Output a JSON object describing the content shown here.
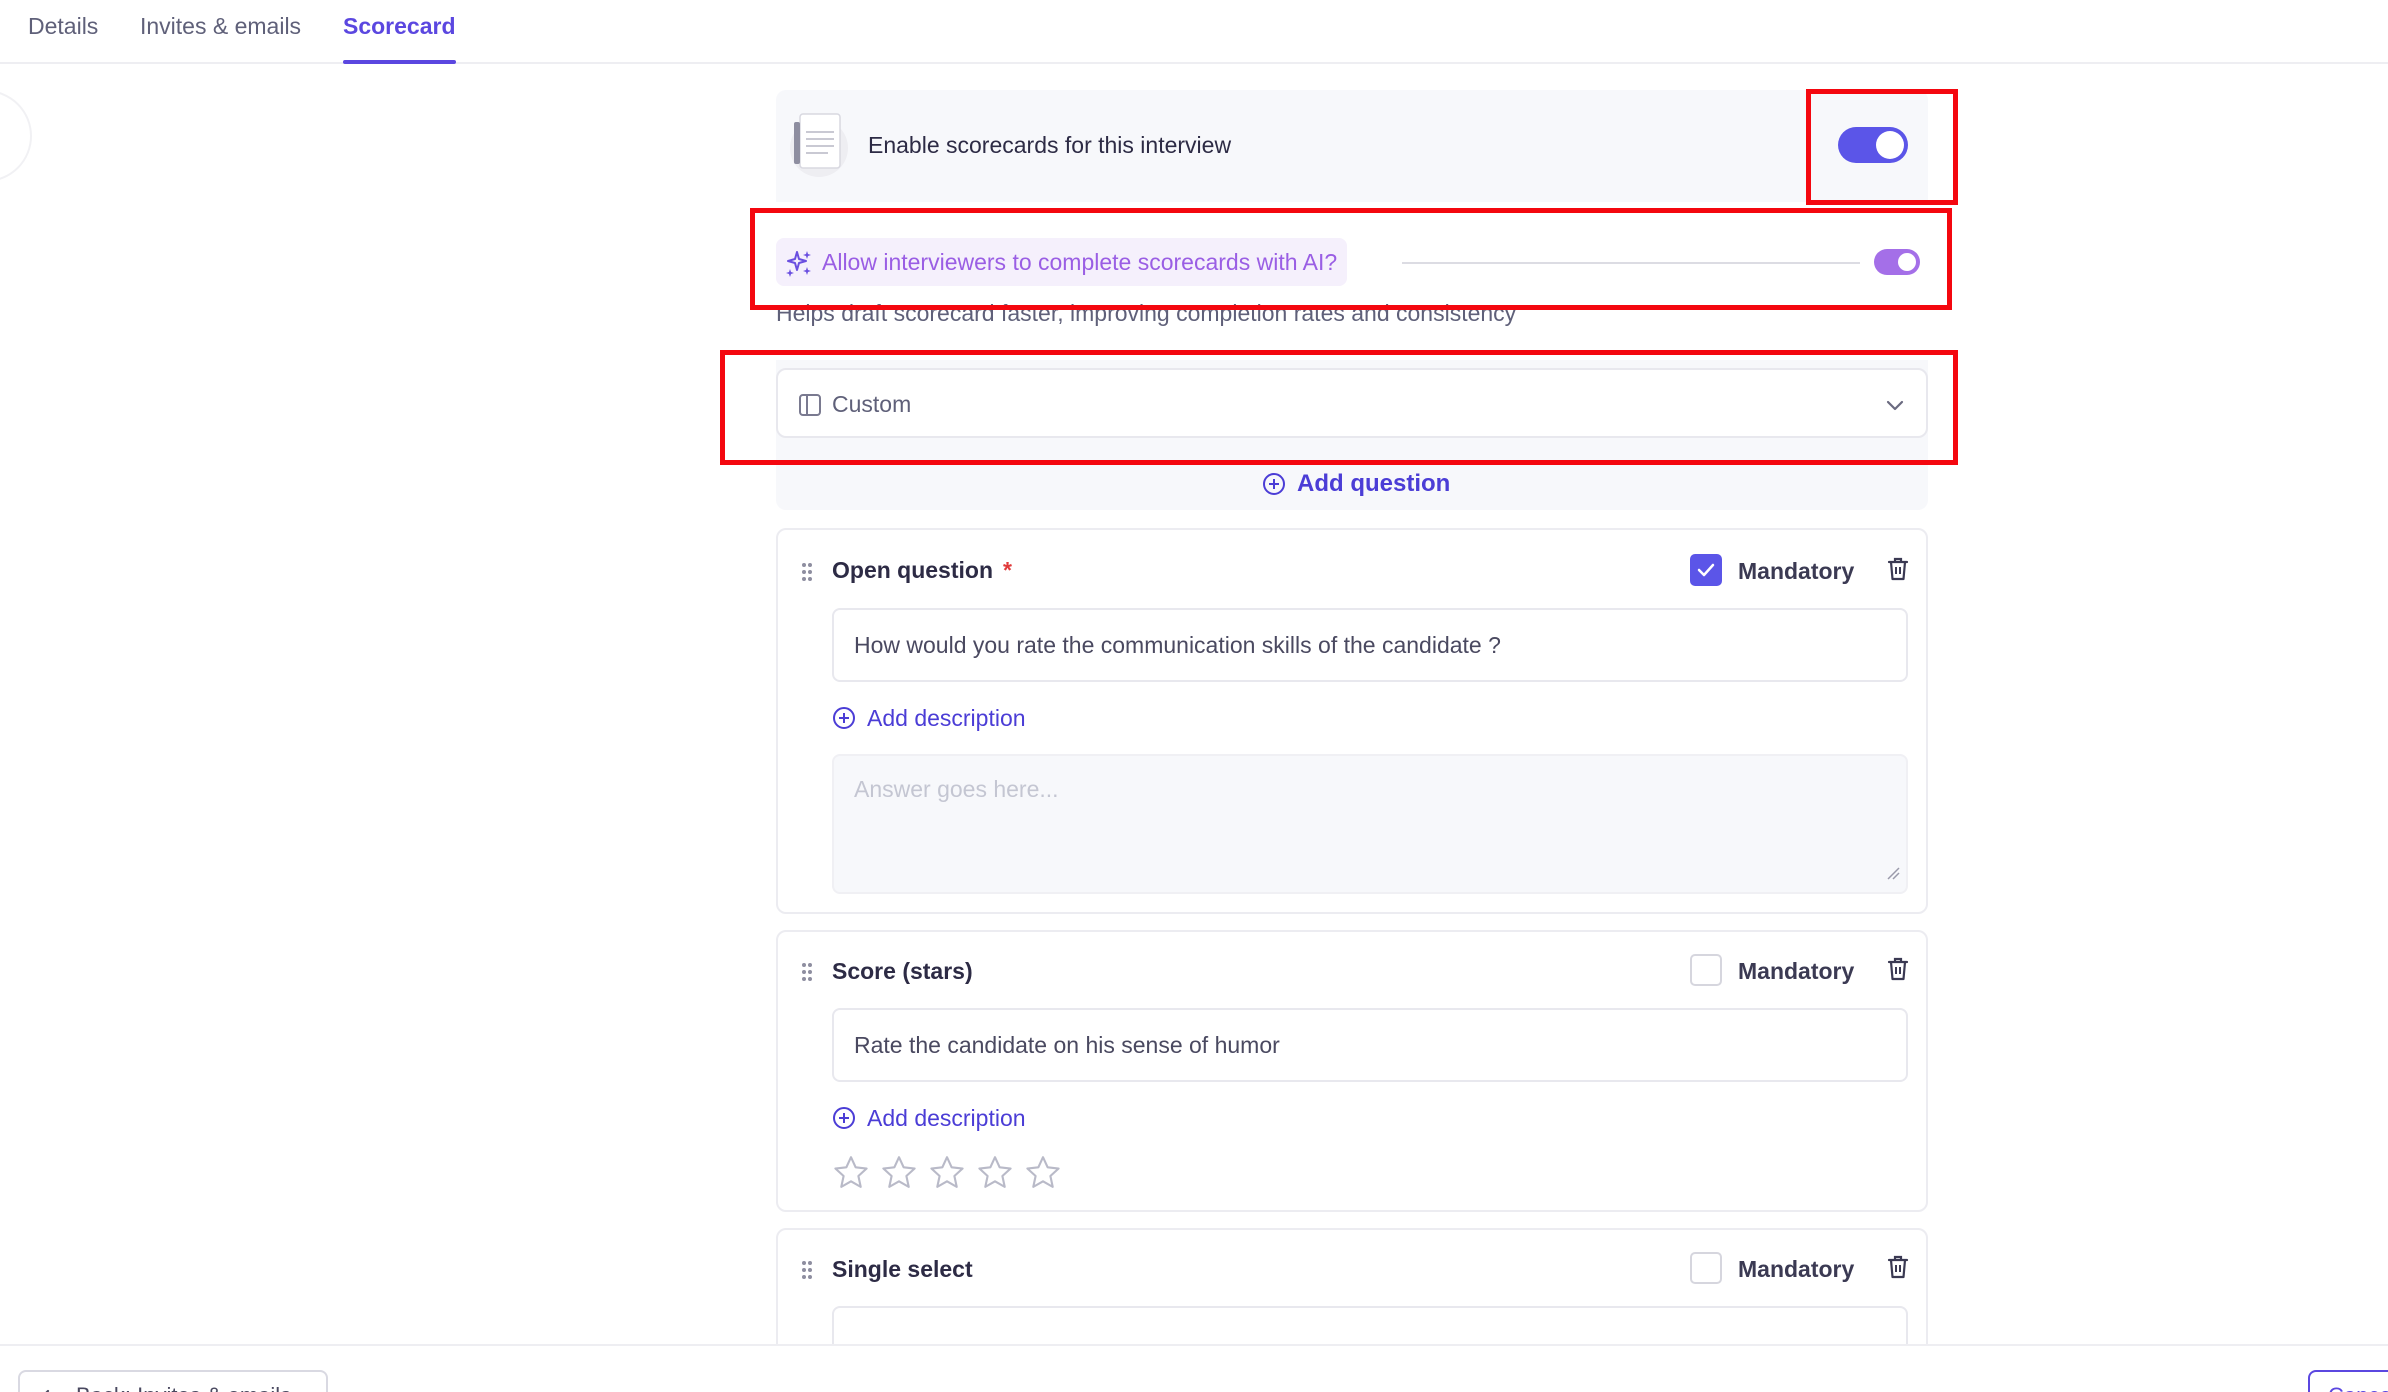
{
  "tabs": [
    {
      "label": "Details",
      "active": false
    },
    {
      "label": "Invites & emails",
      "active": false
    },
    {
      "label": "Scorecard",
      "active": true
    }
  ],
  "scorecard": {
    "enable_label": "Enable scorecards for this interview",
    "enable_on": true,
    "ai_label": "Allow interviewers to complete scorecards with AI?",
    "ai_on": true,
    "ai_help": "Helps draft scorecard faster, improving completion rates and consistency",
    "template_value": "Custom",
    "add_question_label": "Add question"
  },
  "questions": [
    {
      "title": "Open question",
      "required_mark": "*",
      "mandatory_label": "Mandatory",
      "mandatory": true,
      "prompt": "How would you rate the communication skills of the candidate ?",
      "add_description_label": "Add description",
      "answer_placeholder": "Answer goes here..."
    },
    {
      "title": "Score (stars)",
      "mandatory_label": "Mandatory",
      "mandatory": false,
      "prompt": "Rate the candidate on his sense of humor",
      "add_description_label": "Add description",
      "stars_total": 5,
      "stars_filled": 0
    },
    {
      "title": "Single select",
      "mandatory_label": "Mandatory",
      "mandatory": false
    }
  ],
  "footer": {
    "back_label": "Back: Invites & emails",
    "cancel_label": "Cancel"
  },
  "colors": {
    "accent": "#5b47e0",
    "toggle": "#5b55e8",
    "ai_accent": "#9a5ee4",
    "annotation": "#f4070f"
  },
  "icons": [
    "document-icon",
    "sparkles-icon",
    "layout-icon",
    "chevron-down-icon",
    "plus-circle-icon",
    "drag-handle-icon",
    "check-icon",
    "trash-icon",
    "star-icon",
    "arrow-left-icon",
    "resize-grip-icon"
  ]
}
